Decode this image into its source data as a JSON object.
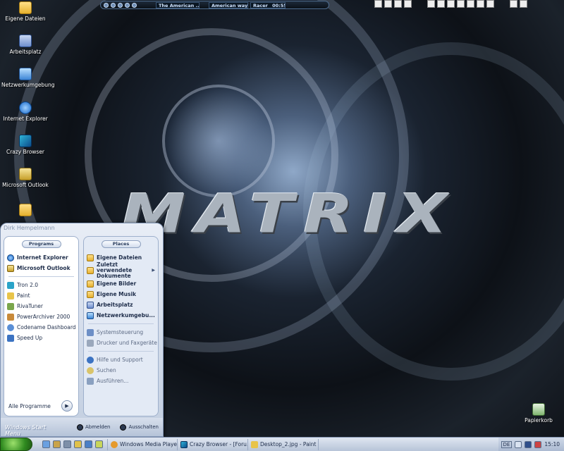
{
  "desktop": {
    "icons": [
      {
        "label": "Eigene Dateien",
        "icon": "folder-icon"
      },
      {
        "label": "Arbeitsplatz",
        "icon": "computer-icon"
      },
      {
        "label": "Netzwerkumgebung",
        "icon": "network-icon"
      },
      {
        "label": "Internet Explorer",
        "icon": "internet-explorer-icon"
      },
      {
        "label": "Crazy Browser",
        "icon": "crazy-browser-icon"
      },
      {
        "label": "Microsoft Outlook",
        "icon": "outlook-icon"
      }
    ],
    "recycle_bin": "Papierkorb",
    "wallpaper_logo": "MATRIX"
  },
  "media_player": {
    "track": "The American ...",
    "title": "American way",
    "label": "Racer",
    "time": "00:55"
  },
  "start_menu": {
    "user": "Dirk Hempelmann",
    "programs_header": "Programs",
    "places_header": "Places",
    "pinned": [
      {
        "label": "Internet Explorer",
        "icon": "internet-explorer-icon"
      },
      {
        "label": "Microsoft Outlook",
        "icon": "outlook-icon"
      }
    ],
    "recent": [
      {
        "label": "Tron 2.0",
        "icon": "tron-icon"
      },
      {
        "label": "Paint",
        "icon": "paint-icon"
      },
      {
        "label": "RivaTuner",
        "icon": "rivatuner-icon"
      },
      {
        "label": "PowerArchiver 2000",
        "icon": "archive-icon"
      },
      {
        "label": "Codename Dashboard",
        "icon": "dashboard-icon"
      },
      {
        "label": "Speed Up",
        "icon": "speed-icon"
      }
    ],
    "all_programs": "Alle Programme",
    "places": [
      {
        "label": "Eigene Dateien",
        "icon": "folder-icon"
      },
      {
        "label": "Zuletzt verwendete Dokumente",
        "icon": "recent-docs-icon"
      },
      {
        "label": "Eigene Bilder",
        "icon": "pictures-icon"
      },
      {
        "label": "Eigene Musik",
        "icon": "music-icon"
      },
      {
        "label": "Arbeitsplatz",
        "icon": "computer-icon"
      },
      {
        "label": "Netzwerkumgebu...",
        "icon": "network-icon"
      }
    ],
    "settings": [
      {
        "label": "Systemsteuerung",
        "icon": "control-panel-icon"
      },
      {
        "label": "Drucker und Faxgeräte",
        "icon": "printer-icon"
      }
    ],
    "help": [
      {
        "label": "Hilfe und Support",
        "icon": "help-icon"
      },
      {
        "label": "Suchen",
        "icon": "search-icon"
      },
      {
        "label": "Ausführen...",
        "icon": "run-icon"
      }
    ],
    "brand": "Windows Start Menu",
    "logoff": "Abmelden",
    "shutdown": "Ausschalten"
  },
  "taskbar": {
    "tasks": [
      {
        "label": "Windows Media Player",
        "icon": "media-player-icon"
      },
      {
        "label": "Crazy Browser - [Foru...",
        "icon": "crazy-browser-icon"
      },
      {
        "label": "Desktop_2.jpg - Paint",
        "icon": "paint-icon"
      }
    ],
    "language": "DE",
    "clock": "15:10"
  },
  "colors": {
    "start_menu_bg": "#e8edf6",
    "taskbar_bg": "#dfe6f1",
    "start_button": "#2f8a1f"
  }
}
